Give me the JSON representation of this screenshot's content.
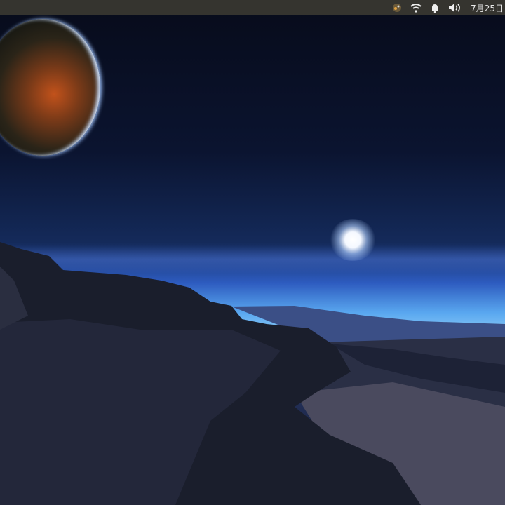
{
  "panel": {
    "indicators": [
      {
        "name": "app-indicator-icon"
      },
      {
        "name": "wifi-icon"
      },
      {
        "name": "notification-bell-icon"
      },
      {
        "name": "volume-icon"
      }
    ],
    "clock": "7月25日"
  },
  "colors": {
    "panel": "#35342f",
    "sky": "#0b1430",
    "horizon": "#5aa8f0"
  }
}
